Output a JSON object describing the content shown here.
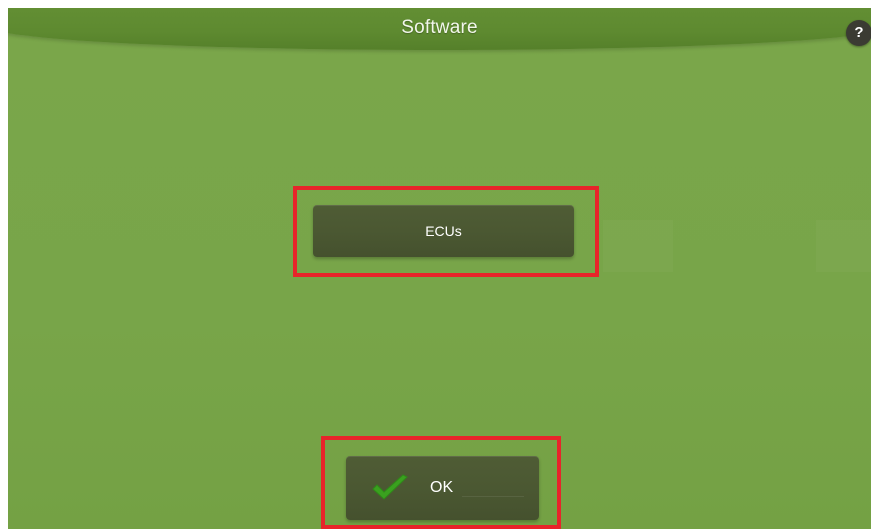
{
  "header": {
    "title": "Software",
    "help_label": "?"
  },
  "main": {
    "ecus_button_label": "ECUs"
  },
  "footer": {
    "ok_button_label": "OK",
    "ok_icon": "checkmark-icon"
  },
  "colors": {
    "background": "#78a549",
    "title_bar": "#5e8a30",
    "button": "#4b5832",
    "highlight": "#e8242a",
    "check": "#3aa11f"
  }
}
